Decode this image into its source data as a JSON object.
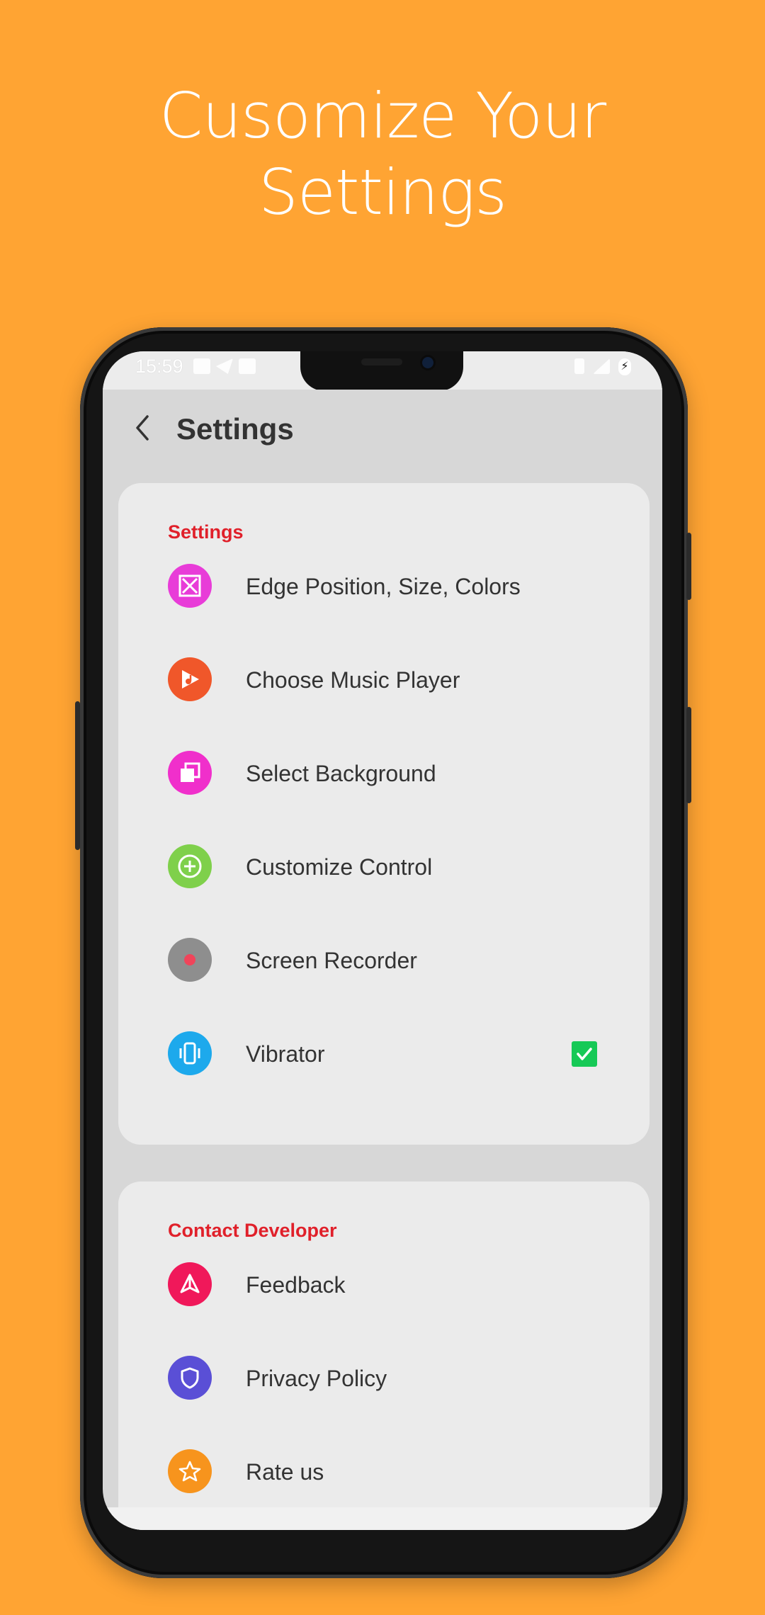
{
  "promo": {
    "headline_line1": "Cusomize Your",
    "headline_line2": "Settings",
    "background_color": "#FFA433"
  },
  "status_bar": {
    "time": "15:59"
  },
  "app_bar": {
    "back_icon": "chevron-left-icon",
    "title": "Settings"
  },
  "sections": [
    {
      "title": "Settings",
      "items": [
        {
          "label": "Edge Position, Size, Colors",
          "icon": "edge-position-icon",
          "icon_color": "#E83CD8"
        },
        {
          "label": "Choose Music Player",
          "icon": "music-player-icon",
          "icon_color": "#F0572A"
        },
        {
          "label": "Select Background",
          "icon": "background-icon",
          "icon_color": "#F02FCB"
        },
        {
          "label": "Customize Control",
          "icon": "add-circle-icon",
          "icon_color": "#7FD04B"
        },
        {
          "label": "Screen Recorder",
          "icon": "record-icon",
          "icon_color": "#8E8E8E"
        },
        {
          "label": "Vibrator",
          "icon": "vibrate-icon",
          "icon_color": "#1DA9EC",
          "checked": true
        }
      ]
    },
    {
      "title": "Contact Developer",
      "items": [
        {
          "label": "Feedback",
          "icon": "send-icon",
          "icon_color": "#F0185A"
        },
        {
          "label": "Privacy Policy",
          "icon": "shield-icon",
          "icon_color": "#5A4FD6"
        },
        {
          "label": "Rate us",
          "icon": "star-icon",
          "icon_color": "#F7941D"
        }
      ]
    }
  ],
  "colors": {
    "section_title": "#E0202A",
    "checkbox": "#16C956"
  }
}
